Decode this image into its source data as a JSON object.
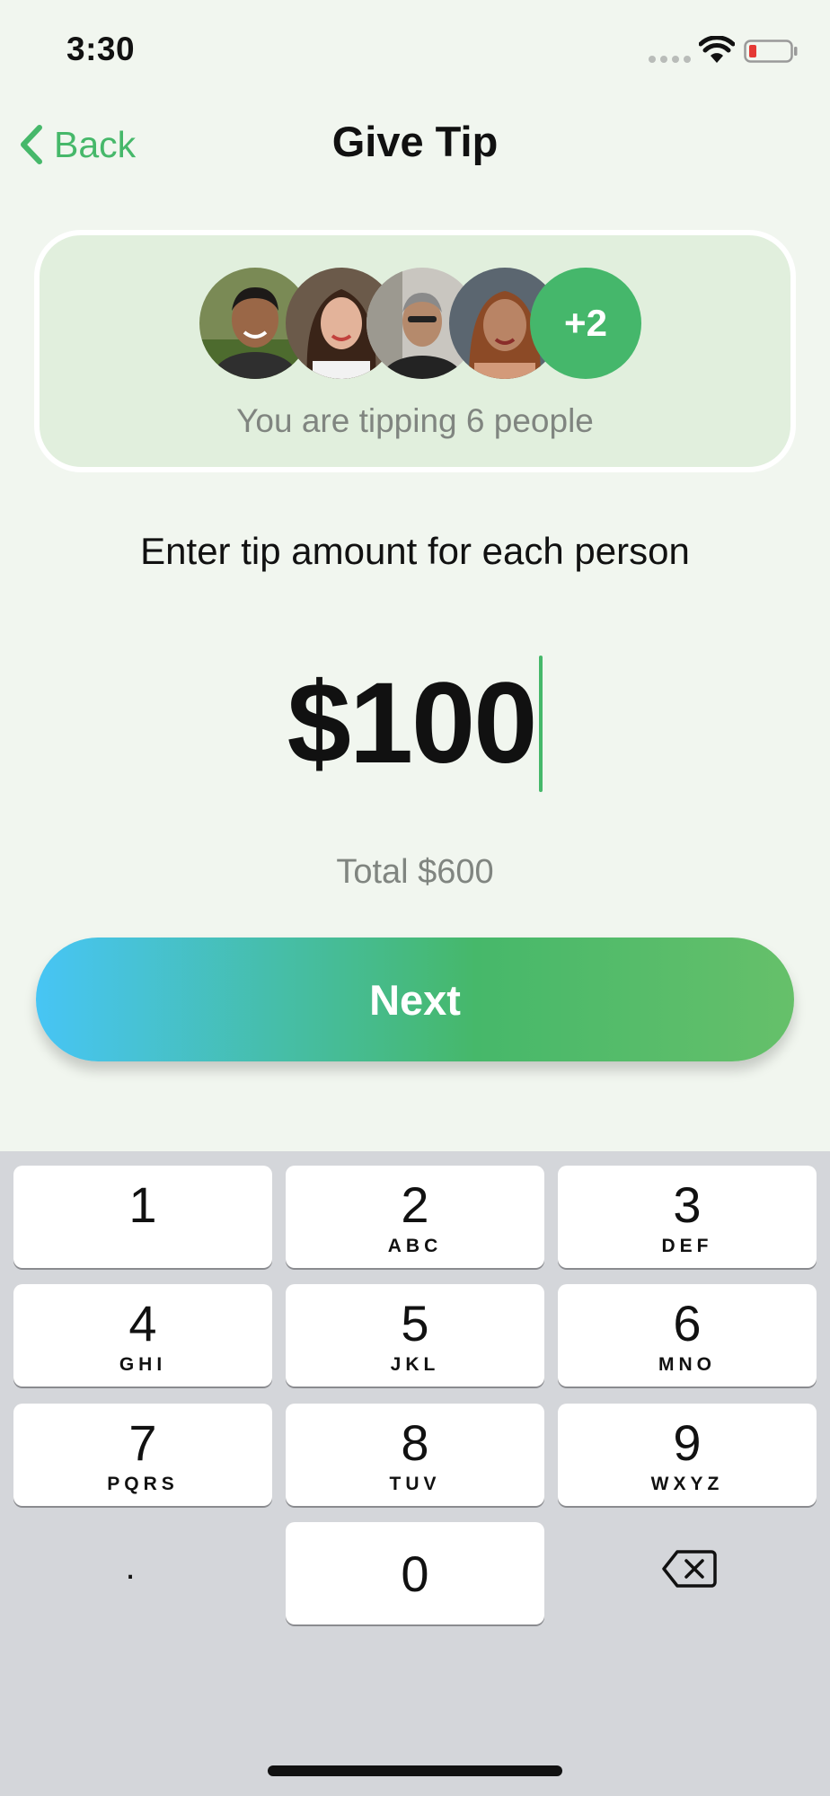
{
  "status_bar": {
    "time": "3:30",
    "battery_color": "#e53935"
  },
  "nav": {
    "back_label": "Back",
    "title": "Give Tip"
  },
  "recipients": {
    "avatars": [
      "avatar-person-1",
      "avatar-person-2",
      "avatar-person-3",
      "avatar-person-4"
    ],
    "more_count": "+2",
    "summary": "You are tipping 6 people"
  },
  "instruction": "Enter tip amount for each person",
  "amount": {
    "value": "$100"
  },
  "total": "Total $600",
  "next_label": "Next",
  "colors": {
    "accent": "#46b86a",
    "gradient_start": "#47c5f5",
    "background": "#f1f6ef"
  },
  "keypad": {
    "keys": [
      {
        "digit": "1",
        "letters": ""
      },
      {
        "digit": "2",
        "letters": "ABC"
      },
      {
        "digit": "3",
        "letters": "DEF"
      },
      {
        "digit": "4",
        "letters": "GHI"
      },
      {
        "digit": "5",
        "letters": "JKL"
      },
      {
        "digit": "6",
        "letters": "MNO"
      },
      {
        "digit": "7",
        "letters": "PQRS"
      },
      {
        "digit": "8",
        "letters": "TUV"
      },
      {
        "digit": "9",
        "letters": "WXYZ"
      },
      {
        "digit": "0",
        "letters": ""
      }
    ],
    "dot": ".",
    "delete_icon": "backspace-icon"
  }
}
